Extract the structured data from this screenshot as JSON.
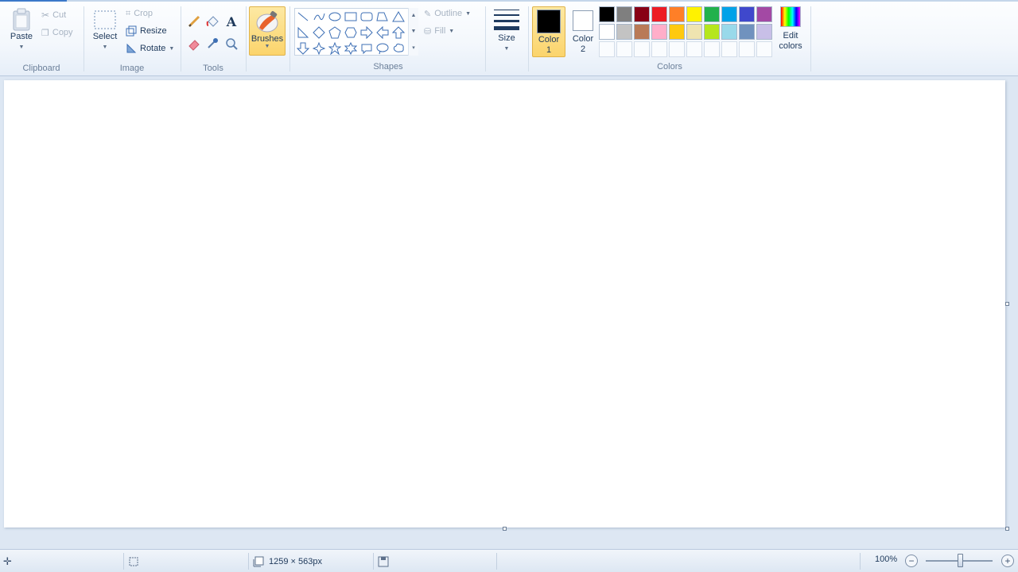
{
  "clipboard": {
    "paste_label": "Paste",
    "cut_label": "Cut",
    "copy_label": "Copy",
    "group_label": "Clipboard"
  },
  "image": {
    "select_label": "Select",
    "crop_label": "Crop",
    "resize_label": "Resize",
    "rotate_label": "Rotate",
    "group_label": "Image"
  },
  "tools": {
    "group_label": "Tools",
    "brushes_label": "Brushes"
  },
  "shapes": {
    "outline_label": "Outline",
    "fill_label": "Fill",
    "group_label": "Shapes"
  },
  "size": {
    "label": "Size"
  },
  "colors": {
    "color1_label_line1": "Color",
    "color1_label_line2": "1",
    "color2_label_line1": "Color",
    "color2_label_line2": "2",
    "color1_value": "#000000",
    "color2_value": "#ffffff",
    "edit_label_line1": "Edit",
    "edit_label_line2": "colors",
    "group_label": "Colors",
    "palette_row1": [
      "#000000",
      "#7f7f7f",
      "#880015",
      "#ed1c24",
      "#ff7f27",
      "#fff200",
      "#22b14c",
      "#00a2e8",
      "#3f48cc",
      "#a349a4"
    ],
    "palette_row2": [
      "#ffffff",
      "#c3c3c3",
      "#b97a57",
      "#ffaec9",
      "#ffc90e",
      "#efe4b0",
      "#b5e61d",
      "#99d9ea",
      "#7092be",
      "#c8bfe7"
    ]
  },
  "status": {
    "dimensions": "1259 × 563px",
    "zoom": "100%",
    "zoom_level": 1.0
  }
}
